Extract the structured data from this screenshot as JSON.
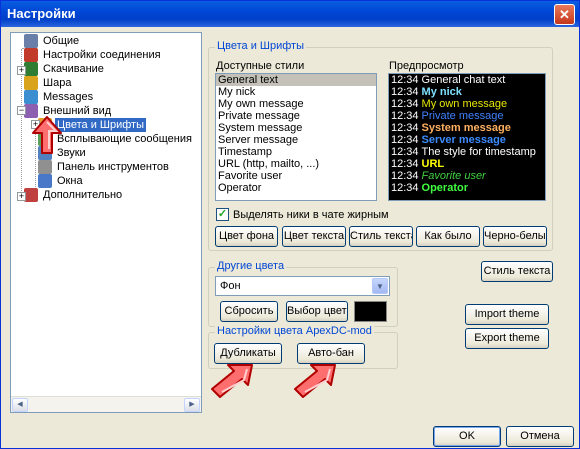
{
  "window": {
    "title": "Настройки",
    "close_glyph": "✕"
  },
  "tree": {
    "items": [
      {
        "label": "Общие",
        "icon": "general-icon",
        "color": "#6a7fa8"
      },
      {
        "label": "Настройки соединения",
        "icon": "connection-icon",
        "color": "#c23a2a"
      },
      {
        "label": "Скачивание",
        "icon": "download-icon",
        "color": "#2e7d32"
      },
      {
        "label": "Шара",
        "icon": "share-icon",
        "color": "#d9a41c"
      },
      {
        "label": "Messages",
        "icon": "messages-icon",
        "color": "#3b8fd0"
      },
      {
        "label": "Внешний вид",
        "icon": "appearance-icon",
        "color": "#8d5fb0"
      },
      {
        "label": "Цвета и Шрифты",
        "icon": "palette-icon",
        "color": "#e0a030"
      },
      {
        "label": "Всплывающие сообщения",
        "icon": "popup-icon",
        "color": "#5aa05a"
      },
      {
        "label": "Звуки",
        "icon": "sound-icon",
        "color": "#5080c0"
      },
      {
        "label": "Панель инструментов",
        "icon": "toolbar-icon",
        "color": "#909090"
      },
      {
        "label": "Окна",
        "icon": "windows-icon",
        "color": "#4a78c8"
      },
      {
        "label": "Дополнительно",
        "icon": "advanced-icon",
        "color": "#c04040"
      }
    ],
    "expander_plus": "+",
    "expander_minus": "−"
  },
  "colors_fonts": {
    "group_title": "Цвета и Шрифты",
    "styles_label": "Доступные стили",
    "preview_label": "Предпросмотр",
    "styles": [
      "General text",
      "My nick",
      "My own message",
      "Private message",
      "System message",
      "Server message",
      "Timestamp",
      "URL (http, mailto, ...)",
      "Favorite user",
      "Operator"
    ],
    "preview": [
      {
        "time": "12:34",
        "text": "General chat text",
        "color": "#ffffff",
        "bold": false,
        "italic": false
      },
      {
        "time": "12:34",
        "text": "My nick",
        "color": "#7fe0ff",
        "bold": true,
        "italic": false
      },
      {
        "time": "12:34",
        "text": "My own message",
        "color": "#e6e600",
        "bold": false,
        "italic": false
      },
      {
        "time": "12:34",
        "text": "Private message",
        "color": "#4080ff",
        "bold": false,
        "italic": false
      },
      {
        "time": "12:34",
        "text": "System message",
        "color": "#ffb060",
        "bold": true,
        "italic": false
      },
      {
        "time": "12:34",
        "text": "Server message",
        "color": "#3c8cff",
        "bold": true,
        "italic": false
      },
      {
        "time": "12:34",
        "text": "The style for timestamp",
        "color": "#ffffff",
        "bold": false,
        "italic": false
      },
      {
        "time": "12:34",
        "text": "URL",
        "color": "#ffff00",
        "bold": true,
        "italic": false
      },
      {
        "time": "12:34",
        "text": "Favorite user",
        "color": "#40d040",
        "bold": false,
        "italic": true
      },
      {
        "time": "12:34",
        "text": "Operator",
        "color": "#40ff40",
        "bold": true,
        "italic": false
      }
    ],
    "bold_nicks_label": "Выделять ники в чате жирным",
    "bold_nicks_checked": "✓",
    "buttons": [
      "Цвет фона",
      "Цвет текста",
      "Стиль текста",
      "Как было",
      "Черно-белый"
    ]
  },
  "other_colors": {
    "group_title": "Другие цвета",
    "combo_value": "Фон",
    "combo_arrow": "▼",
    "reset_label": "Сбросить",
    "choose_label": "Выбор цвета",
    "swatch_color": "#000000"
  },
  "apex": {
    "group_title": "Настройки цвета ApexDC-mod",
    "duplicates_label": "Дубликаты",
    "autoban_label": "Авто-бан"
  },
  "right_buttons": {
    "text_style": "Стиль текста",
    "import_theme": "Import theme",
    "export_theme": "Export theme"
  },
  "footer": {
    "ok": "OK",
    "cancel": "Отмена"
  },
  "scroll": {
    "left": "◀",
    "right": "▶"
  }
}
